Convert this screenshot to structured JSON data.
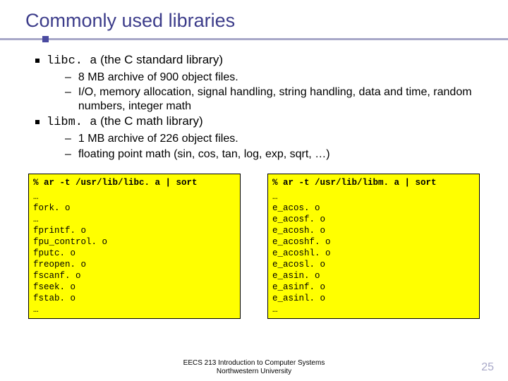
{
  "title": "Commonly used libraries",
  "bullets": [
    {
      "code": "libc. a",
      "desc": " (the C standard library)",
      "sub": [
        "8 MB archive of 900 object files.",
        "I/O, memory allocation, signal handling, string handling, data and time, random numbers, integer math"
      ]
    },
    {
      "code": "libm. a",
      "desc": " (the C math library)",
      "sub": [
        "1 MB archive of 226 object files.",
        "floating point math (sin, cos, tan, log, exp, sqrt, …)"
      ]
    }
  ],
  "boxes": [
    {
      "cmd": "% ar -t /usr/lib/libc. a | sort",
      "lines": [
        "…",
        "fork. o",
        "…",
        "fprintf. o",
        "fpu_control. o",
        "fputc. o",
        "freopen. o",
        "fscanf. o",
        "fseek. o",
        "fstab. o",
        "…"
      ]
    },
    {
      "cmd": "% ar -t /usr/lib/libm. a | sort",
      "lines": [
        "…",
        "e_acos. o",
        "e_acosf. o",
        "e_acosh. o",
        "e_acoshf. o",
        "e_acoshl. o",
        "e_acosl. o",
        "e_asin. o",
        "e_asinf. o",
        "e_asinl. o",
        "…"
      ]
    }
  ],
  "footer": {
    "line1": "EECS 213 Introduction to Computer Systems",
    "line2": "Northwestern University"
  },
  "pagenum": "25"
}
